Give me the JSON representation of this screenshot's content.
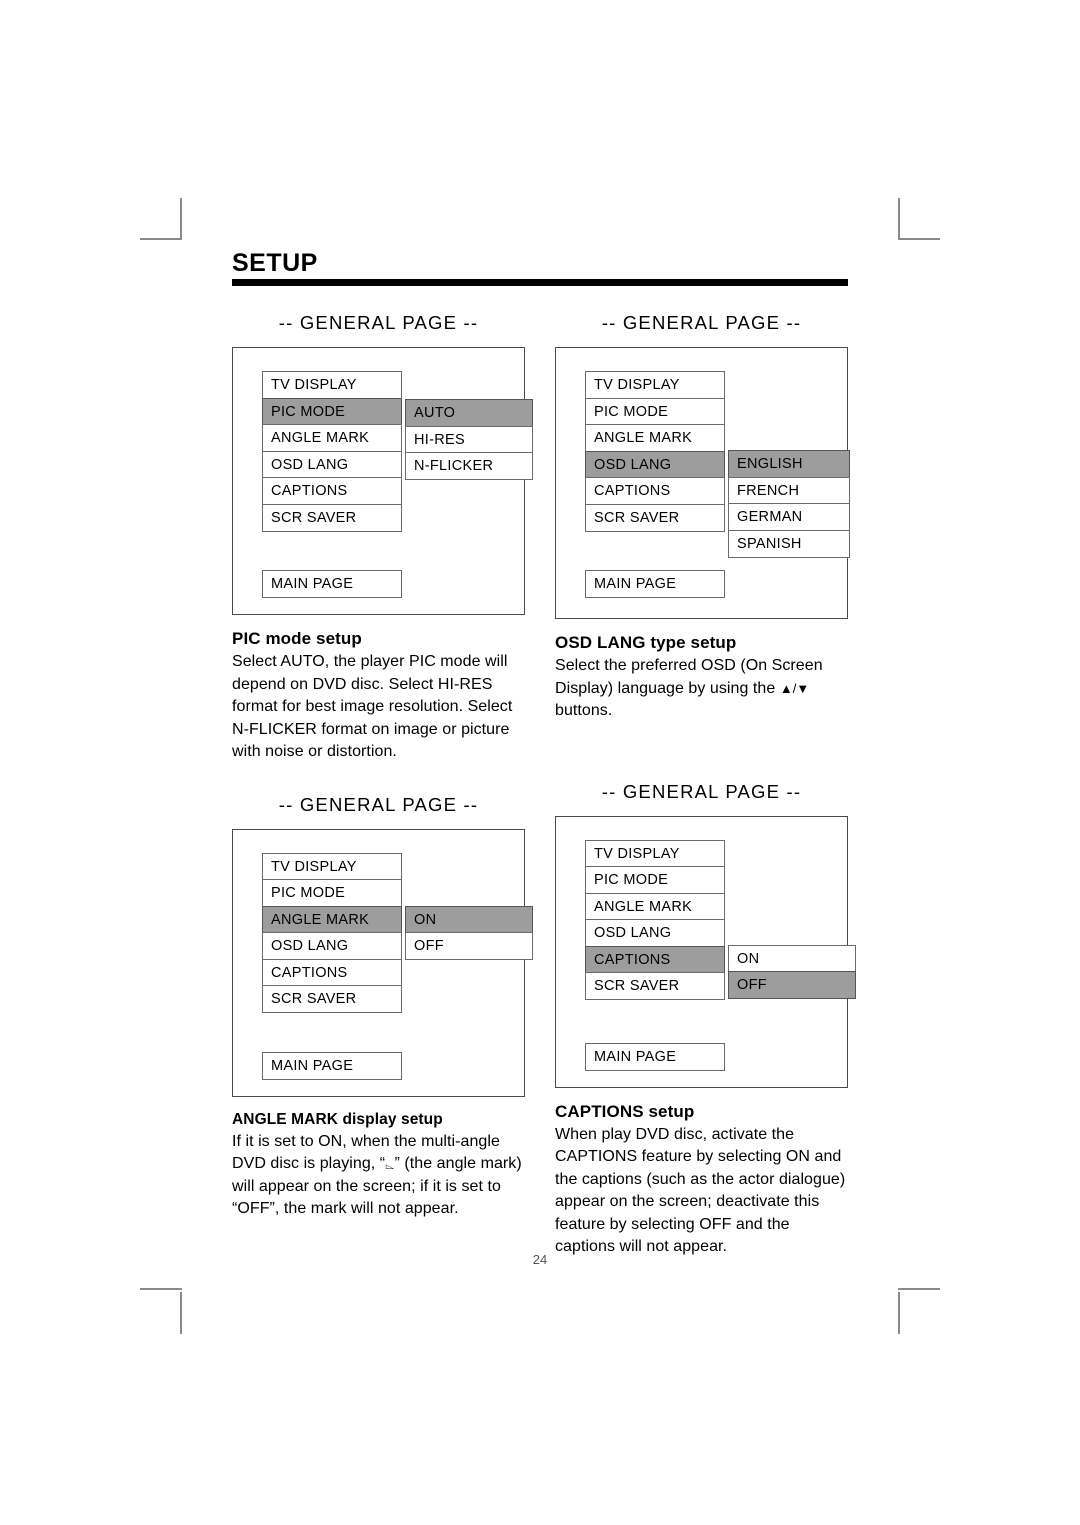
{
  "document": {
    "heading": "SETUP",
    "page_number": "24"
  },
  "panels": [
    {
      "header": "-- GENERAL PAGE --",
      "menu_items": [
        {
          "label": "TV DISPLAY",
          "highlighted": false
        },
        {
          "label": "PIC MODE",
          "highlighted": true
        },
        {
          "label": "ANGLE MARK",
          "highlighted": false
        },
        {
          "label": "OSD LANG",
          "highlighted": false
        },
        {
          "label": "CAPTIONS",
          "highlighted": false
        },
        {
          "label": "SCR SAVER",
          "highlighted": false
        }
      ],
      "submenu": [
        {
          "label": "AUTO",
          "highlighted": true
        },
        {
          "label": "HI-RES",
          "highlighted": false
        },
        {
          "label": "N-FLICKER",
          "highlighted": false
        }
      ],
      "main_page": "MAIN PAGE"
    },
    {
      "header": "-- GENERAL PAGE --",
      "menu_items": [
        {
          "label": "TV DISPLAY",
          "highlighted": false
        },
        {
          "label": "PIC MODE",
          "highlighted": false
        },
        {
          "label": "ANGLE MARK",
          "highlighted": false
        },
        {
          "label": "OSD LANG",
          "highlighted": true
        },
        {
          "label": "CAPTIONS",
          "highlighted": false
        },
        {
          "label": "SCR SAVER",
          "highlighted": false
        }
      ],
      "submenu": [
        {
          "label": "ENGLISH",
          "highlighted": true
        },
        {
          "label": "FRENCH",
          "highlighted": false
        },
        {
          "label": "GERMAN",
          "highlighted": false
        },
        {
          "label": "SPANISH",
          "highlighted": false
        }
      ],
      "main_page": "MAIN PAGE"
    },
    {
      "header": "-- GENERAL PAGE --",
      "menu_items": [
        {
          "label": "TV DISPLAY",
          "highlighted": false
        },
        {
          "label": "PIC MODE",
          "highlighted": false
        },
        {
          "label": "ANGLE MARK",
          "highlighted": true
        },
        {
          "label": "OSD LANG",
          "highlighted": false
        },
        {
          "label": "CAPTIONS",
          "highlighted": false
        },
        {
          "label": "SCR SAVER",
          "highlighted": false
        }
      ],
      "submenu": [
        {
          "label": "ON",
          "highlighted": true
        },
        {
          "label": "OFF",
          "highlighted": false
        }
      ],
      "main_page": "MAIN PAGE"
    },
    {
      "header": "-- GENERAL PAGE --",
      "menu_items": [
        {
          "label": "TV DISPLAY",
          "highlighted": false
        },
        {
          "label": "PIC MODE",
          "highlighted": false
        },
        {
          "label": "ANGLE MARK",
          "highlighted": false
        },
        {
          "label": "OSD LANG",
          "highlighted": false
        },
        {
          "label": "CAPTIONS",
          "highlighted": true
        },
        {
          "label": "SCR SAVER",
          "highlighted": false
        }
      ],
      "submenu": [
        {
          "label": "ON",
          "highlighted": false
        },
        {
          "label": "OFF",
          "highlighted": true
        }
      ],
      "main_page": "MAIN PAGE"
    }
  ],
  "sections": {
    "pic_mode": {
      "title": "PIC mode setup",
      "body": "Select AUTO, the player PIC mode will depend on DVD disc. Select HI-RES format for best image resolution. Select N-FLICKER format on image or picture with noise or distortion."
    },
    "osd_lang": {
      "title": "OSD LANG type setup",
      "body_before": "Select the preferred OSD (On Screen Display) language by using the ",
      "arrows": "▲/▼",
      "body_after": " buttons."
    },
    "angle_mark": {
      "title": "ANGLE MARK display setup",
      "body_before": "If it is set to ON, when the multi-angle DVD disc is playing, “",
      "glyph": "⌳",
      "body_after": "” (the angle mark) will appear on the screen; if it is set to “OFF”, the mark will not appear."
    },
    "captions": {
      "title": "CAPTIONS setup",
      "body": "When play DVD disc, activate the CAPTIONS feature by selecting ON and the captions (such as the actor dialogue) appear on the screen; deactivate this feature by selecting OFF and the captions will not appear."
    }
  },
  "colors": {
    "highlight": "#9d9d9d",
    "border": "#6b6b6b",
    "panel_border": "#4a4a4a",
    "rule": "#000000"
  }
}
